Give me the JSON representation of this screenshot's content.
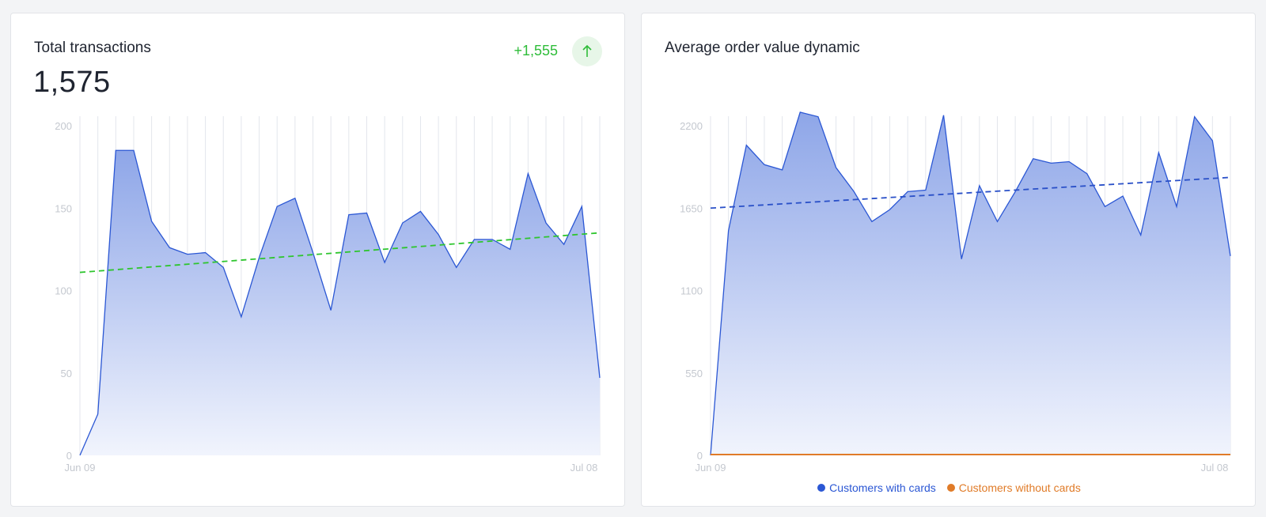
{
  "colors": {
    "series_line": "#2b57d4",
    "area_top": "#8ea6e8",
    "area_bottom": "#f1f4fd",
    "trend_green": "#2ec52e",
    "trend_blue": "#2a50c8",
    "orange": "#e07b28",
    "grid": "#e3e6ec",
    "tick": "#c4c8cf",
    "delta_green": "#2fbd3a"
  },
  "card1": {
    "title": "Total transactions",
    "value": "1,575",
    "delta": "+1,555",
    "delta_icon": "arrow-up-icon"
  },
  "card2": {
    "title": "Average order value dynamic",
    "legend": [
      {
        "label": "Customers with cards",
        "color": "#2b57d4"
      },
      {
        "label": "Customers without cards",
        "color": "#e07b28"
      }
    ]
  },
  "chart_data": [
    {
      "type": "area",
      "title": "Total transactions",
      "x_tick_labels": [
        "Jun 09",
        "Jul 08"
      ],
      "y_ticks": [
        0,
        50,
        100,
        150,
        200
      ],
      "ylim": [
        0,
        200
      ],
      "grid": "vertical",
      "trendline": {
        "start": 111,
        "end": 135
      },
      "series": [
        {
          "values": [
            0,
            25,
            185,
            185,
            142,
            126,
            122,
            123,
            114,
            84,
            120,
            151,
            156,
            123,
            88,
            146,
            147,
            117,
            141,
            148,
            134,
            114,
            131,
            131,
            125,
            171,
            141,
            128,
            151,
            47
          ]
        }
      ]
    },
    {
      "type": "area",
      "title": "Average order value dynamic",
      "x_tick_labels": [
        "Jun 09",
        "Jul 08"
      ],
      "y_ticks": [
        0,
        550,
        1100,
        1650,
        2200
      ],
      "ylim": [
        0,
        2200
      ],
      "grid": "vertical",
      "legend_position": "bottom",
      "series": [
        {
          "name": "Customers with cards",
          "values": [
            0,
            1500,
            2070,
            1940,
            1905,
            2290,
            2260,
            1920,
            1760,
            1560,
            1640,
            1760,
            1770,
            2270,
            1310,
            1800,
            1560,
            1760,
            1980,
            1950,
            1960,
            1880,
            1660,
            1730,
            1470,
            2020,
            1660,
            2260,
            2100,
            1330
          ],
          "trendline": {
            "start": 1650,
            "end": 1855
          }
        },
        {
          "name": "Customers without cards",
          "values": [
            0,
            0,
            0,
            0,
            0,
            0,
            0,
            0,
            0,
            0,
            0,
            0,
            0,
            0,
            0,
            0,
            0,
            0,
            0,
            0,
            0,
            0,
            0,
            0,
            0,
            0,
            0,
            0,
            0,
            0
          ],
          "trendline": {
            "start": 0,
            "end": 0
          }
        }
      ]
    }
  ]
}
